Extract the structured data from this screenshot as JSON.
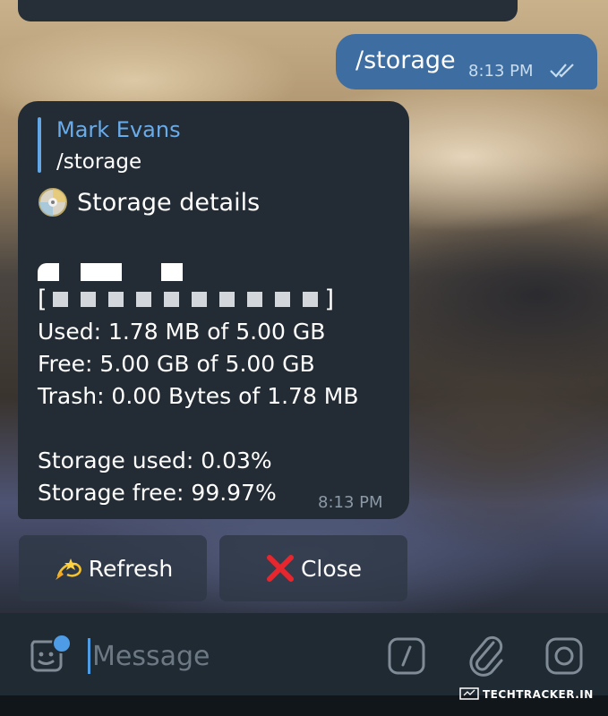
{
  "outgoing": {
    "text": "/storage",
    "time": "8:13 PM",
    "status_icon": "double-check-icon"
  },
  "incoming": {
    "reply_to": {
      "name": "Mark Evans",
      "text": "/storage"
    },
    "title_icon": "dvd-icon",
    "title": "Storage details",
    "progress_open": "[",
    "progress_close": "]",
    "used": "Used: 1.78 MB of 5.00 GB",
    "free": "Free: 5.00 GB of 5.00 GB",
    "trash": "Trash: 0.00 Bytes of 1.78 MB",
    "storage_used": "Storage used: 0.03%",
    "storage_free": "Storage free: 99.97%",
    "time": "8:13 PM"
  },
  "keyboard": {
    "refresh_label": "Refresh",
    "close_label": "Close"
  },
  "input": {
    "placeholder": "Message",
    "value": ""
  },
  "watermark": {
    "text": "TechTracker.in"
  },
  "colors": {
    "outgoing_bubble": "#3e6ea1",
    "incoming_bubble": "#232c35",
    "accent": "#6aabea",
    "close_red": "#e8262d"
  }
}
